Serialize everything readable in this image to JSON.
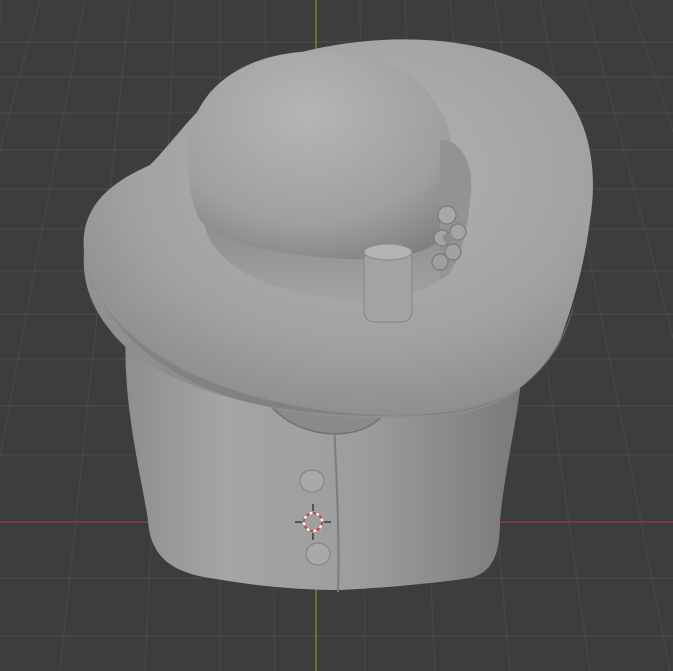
{
  "app": {
    "name": "3D Viewport"
  },
  "viewport": {
    "mode": "solid-shading",
    "background": "#3d3d3d",
    "grid_line_color": "#4a4a4a",
    "x_axis_color": "#8a3a45",
    "y_axis_color": "#6a8a2a",
    "mesh_color": "#9c9c9c",
    "cursor_colors": [
      "#d33a3a",
      "#ffffff"
    ]
  },
  "scene": {
    "object": "hat-and-coat-sculpt",
    "icons": {
      "cursor": "3d-cursor-icon"
    }
  }
}
